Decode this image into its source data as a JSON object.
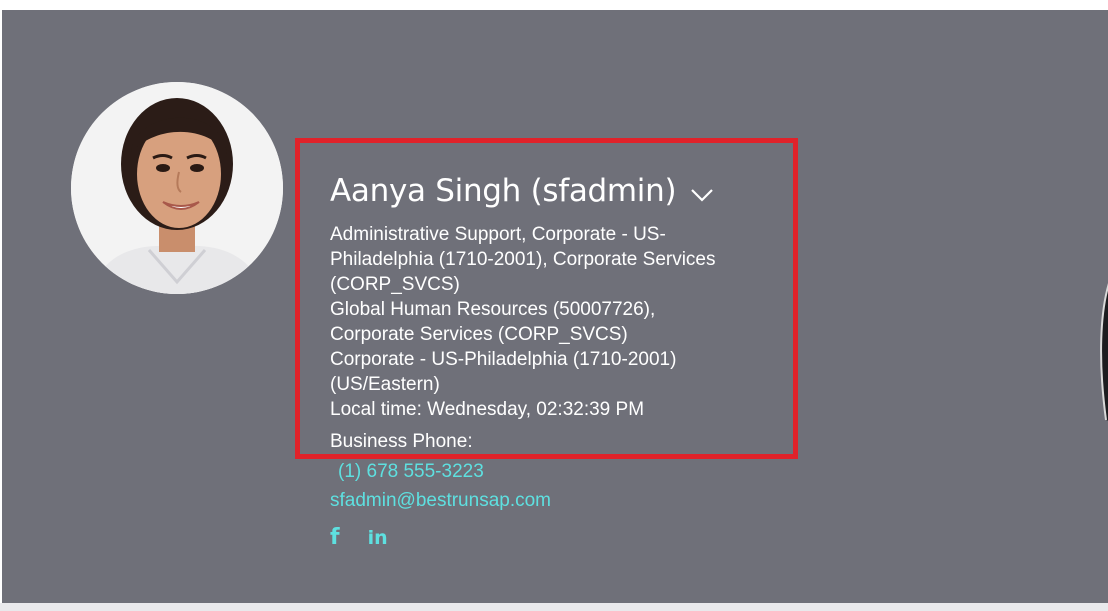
{
  "profile": {
    "name": "Aanya Singh (sfadmin)",
    "details": [
      "Administrative Support, Corporate - US-",
      "Philadelphia (1710-2001), Corporate Services",
      "(CORP_SVCS)",
      "Global Human Resources (50007726),",
      "Corporate Services (CORP_SVCS)",
      "Corporate - US-Philadelphia (1710-2001)",
      "(US/Eastern)",
      "Local time: Wednesday, 02:32:39 PM"
    ],
    "phone_label": "Business Phone:",
    "phone_value": "(1) 678 555-3223",
    "email": "sfadmin@bestrunsap.com",
    "social": {
      "facebook_glyph": "f",
      "linkedin_glyph": "in"
    }
  },
  "icons": {
    "name_menu": "chevron-down-icon",
    "facebook": "facebook-icon",
    "linkedin": "linkedin-icon"
  },
  "colors": {
    "header_background": "#6f7079",
    "link_color": "#5ee0e0",
    "highlight_border": "#e0222a",
    "text": "#ffffff"
  }
}
